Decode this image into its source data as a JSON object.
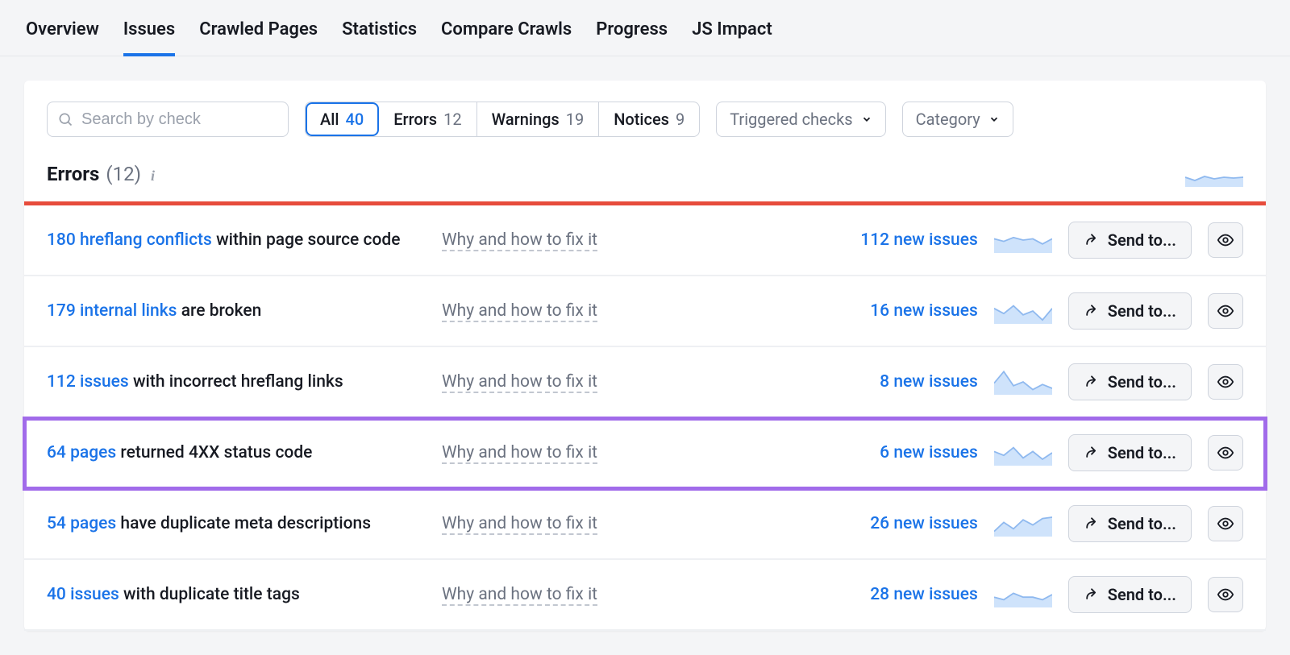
{
  "tabs": [
    {
      "label": "Overview",
      "active": false
    },
    {
      "label": "Issues",
      "active": true
    },
    {
      "label": "Crawled Pages",
      "active": false
    },
    {
      "label": "Statistics",
      "active": false
    },
    {
      "label": "Compare Crawls",
      "active": false
    },
    {
      "label": "Progress",
      "active": false
    },
    {
      "label": "JS Impact",
      "active": false
    }
  ],
  "search": {
    "placeholder": "Search by check"
  },
  "filters": [
    {
      "label": "All",
      "count": "40",
      "active": true
    },
    {
      "label": "Errors",
      "count": "12",
      "active": false
    },
    {
      "label": "Warnings",
      "count": "19",
      "active": false
    },
    {
      "label": "Notices",
      "count": "9",
      "active": false
    }
  ],
  "dropdowns": {
    "triggered": "Triggered checks",
    "category": "Category"
  },
  "section": {
    "title": "Errors",
    "count": "(12)"
  },
  "fix_label": "Why and how to fix it",
  "send_label": "Send to...",
  "rows": [
    {
      "link": "180 hreflang conflicts",
      "rest": " within page source code",
      "new_issues": "112 new issues",
      "spark": [
        0.55,
        0.45,
        0.6,
        0.5,
        0.55,
        0.35,
        0.55
      ],
      "highlight": false
    },
    {
      "link": "179 internal links",
      "rest": " are broken",
      "new_issues": "16 new issues",
      "spark": [
        0.6,
        0.4,
        0.7,
        0.35,
        0.5,
        0.15,
        0.6
      ],
      "highlight": false
    },
    {
      "link": "112 issues",
      "rest": " with incorrect hreflang links",
      "new_issues": "8 new issues",
      "spark": [
        0.45,
        0.9,
        0.35,
        0.5,
        0.2,
        0.4,
        0.25
      ],
      "highlight": false
    },
    {
      "link": "64 pages",
      "rest": " returned 4XX status code",
      "new_issues": "6 new issues",
      "spark": [
        0.55,
        0.4,
        0.7,
        0.3,
        0.55,
        0.25,
        0.5
      ],
      "highlight": true
    },
    {
      "link": "54 pages",
      "rest": " have duplicate meta descriptions",
      "new_issues": "26 new issues",
      "spark": [
        0.2,
        0.55,
        0.3,
        0.65,
        0.45,
        0.7,
        0.75
      ],
      "highlight": false
    },
    {
      "link": "40 issues",
      "rest": " with duplicate title tags",
      "new_issues": "28 new issues",
      "spark": [
        0.4,
        0.3,
        0.55,
        0.4,
        0.4,
        0.3,
        0.5
      ],
      "highlight": false
    }
  ]
}
